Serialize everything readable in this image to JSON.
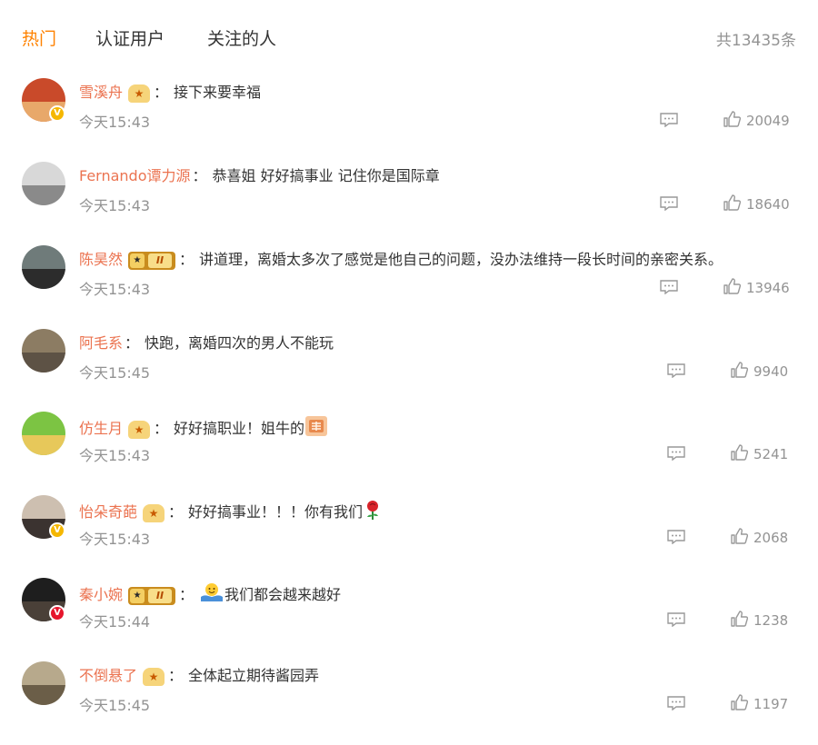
{
  "tabs": [
    {
      "label": "热门"
    },
    {
      "label": "认证用户"
    },
    {
      "label": "关注的人"
    }
  ],
  "total": "共13435条",
  "comments": [
    {
      "user": "雪溪舟",
      "sep": "：",
      "text": "接下来要幸福",
      "time": "今天15:43",
      "likes": "20049"
    },
    {
      "user": "Fernando谭力源",
      "sep": "：",
      "text": "恭喜姐 好好搞事业 记住你是国际章",
      "time": "今天15:43",
      "likes": "18640"
    },
    {
      "user": "陈昊然",
      "sep": "：",
      "text": "讲道理，离婚太多次了感觉是他自己的问题，没办法维持一段长时间的亲密关系。",
      "time": "今天15:43",
      "likes": "13946"
    },
    {
      "user": "阿毛系",
      "sep": "：",
      "text": "快跑，离婚四次的男人不能玩",
      "time": "今天15:45",
      "likes": "9940"
    },
    {
      "user": "仿生月",
      "sep": "：",
      "text": "好好搞职业！姐牛的",
      "time": "今天15:43",
      "likes": "5241"
    },
    {
      "user": "怡朵奇葩",
      "sep": "：",
      "text": "好好搞事业！！！你有我们",
      "time": "今天15:43",
      "likes": "2068"
    },
    {
      "user": "秦小婉",
      "sep": "：",
      "text": "我们都会越来越好",
      "time": "今天15:44",
      "likes": "1238"
    },
    {
      "user": "不倒悬了",
      "sep": "：",
      "text": "全体起立期待酱园弄",
      "time": "今天15:45",
      "likes": "1197"
    }
  ],
  "badges": {
    "crown_level": "II",
    "verified_mark": "V"
  },
  "colors": {
    "accent": "#ff8200",
    "username": "#eb7350",
    "meta": "#939393",
    "text": "#333333",
    "verified_yellow": "#f5b700",
    "verified_red": "#e6162d"
  },
  "icons": {
    "reply": "comment-bubble-icon",
    "like": "thumb-up-icon",
    "crown": "vip-crown-icon",
    "emoji_zan": "zan-sticker-emoji",
    "emoji_rose": "rose-emoji",
    "emoji_hug": "hug-emoji"
  }
}
